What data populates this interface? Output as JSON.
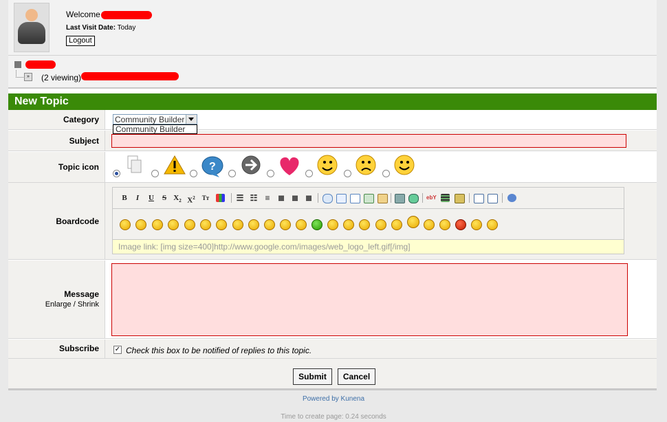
{
  "user": {
    "welcome": "Welcome",
    "last_visit_label": "Last Visit Date:",
    "last_visit_value": "Today",
    "logout_label": "Logout"
  },
  "pathway": {
    "viewing": "(2 viewing)"
  },
  "form": {
    "title": "New Topic",
    "category_label": "Category",
    "category_selected": "Community Builder",
    "category_option": "Community Builder",
    "subject_label": "Subject",
    "subject_value": "",
    "topic_icon_label": "Topic icon",
    "boardcode_label": "Boardcode",
    "boardcode_help": "Image link: [img size=400]http://www.google.com/images/web_logo_left.gif[/img]",
    "message_label": "Message",
    "enlarge_label": "Enlarge",
    "enlarge_sep": "/",
    "shrink_label": "Shrink",
    "subscribe_label": "Subscribe",
    "subscribe_text": "Check this box to be notified of replies to this topic.",
    "subscribe_checked": true,
    "submit_label": "Submit",
    "cancel_label": "Cancel"
  },
  "toolbar": {
    "bold": "B",
    "italic": "I",
    "underline": "U",
    "strike": "S",
    "subscript": "X",
    "subscript_mark": "2",
    "superscript": "X",
    "superscript_mark": "2",
    "size": "Tт"
  },
  "footer": {
    "powered": "Powered by Kunena",
    "time": "Time to create page: 0.24 seconds"
  },
  "colors": {
    "header_green": "#3a8a08",
    "required_bg": "#ffdede",
    "required_border": "#cc0000",
    "help_bg": "#ffffd0"
  }
}
